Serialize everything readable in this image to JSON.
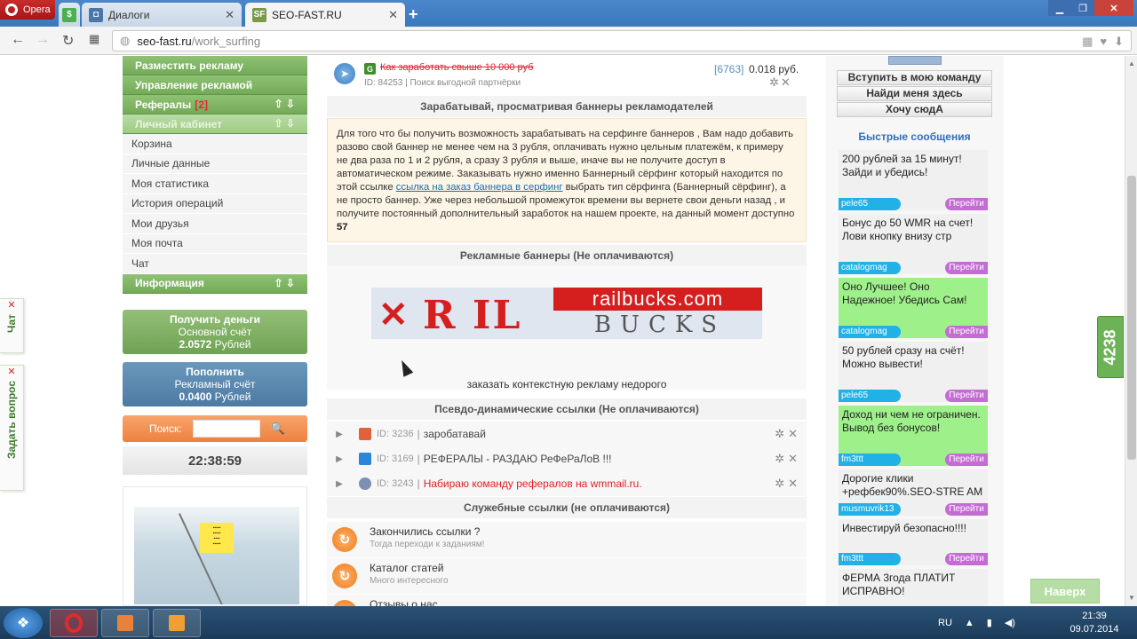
{
  "browser": {
    "opera_label": "Opera",
    "tabs": [
      {
        "title": ""
      },
      {
        "title": "Диалоги"
      },
      {
        "title": "SEO-FAST.RU"
      }
    ],
    "url_domain": "seo-fast.ru",
    "url_path": "/work_surfing"
  },
  "sidebar": {
    "menu": [
      {
        "label": "Разместить рекламу",
        "style": "green"
      },
      {
        "label": "Управление рекламой",
        "style": "green"
      },
      {
        "label": "Рефералы",
        "count": "[2]",
        "style": "green"
      },
      {
        "label": "Личный кабинет",
        "style": "light"
      }
    ],
    "links": [
      "Корзина",
      "Личные данные",
      "Моя статистика",
      "История операций",
      "Мои друзья",
      "Моя почта",
      "Чат"
    ],
    "info_label": "Информация",
    "earn": {
      "title": "Получить деньги",
      "sub": "Основной счёт",
      "amount": "2.0572",
      "unit": "Рублей"
    },
    "pay": {
      "title": "Пополнить",
      "sub": "Рекламный счёт",
      "amount": "0.0400",
      "unit": "Рублей"
    },
    "search_label": "Поиск:",
    "clock": "22:38:59"
  },
  "edge_tabs": {
    "chat": "Чат",
    "ask": "Задать вопрос"
  },
  "center": {
    "top_link": {
      "title": "Как заработать свыше 10 000 руб",
      "meta": "ID: 84253 | Поиск выгодной партнёрки",
      "views": "[6763]",
      "price": "0.018 руб."
    },
    "earn_title": "Зарабатывай, просматривая баннеры рекламодателей",
    "info": {
      "text_before": "Для того что бы получить возможность зарабатывать на серфинге баннеров , Вам надо добавить разово свой баннер не менее чем на 3 рубля, оплачивать нужно цельным платежём, к примеру не два раза по 1 и 2 рубля, а сразу 3 рубля и выше, иначе вы не получите доступ в автоматическом режиме. Заказывать нужно именно Баннерный сёрфинг который находится по этой ссылке",
      "link": "ссылка на заказ баннера в серфинг",
      "text_after": "выбрать тип сёрфинга (Баннерный сёрфинг), а не просто баннер. Уже через небольшой промежуток времени вы вернете свои деньги назад , и получите постоянный дополнительный заработок на нашем проекте, на данный момент доступно",
      "count": "57"
    },
    "banners_title": "Рекламные баннеры (Не оплачиваются)",
    "banner": {
      "brand": "R  IL",
      "url": "railbucks.com",
      "word": "BUCKS"
    },
    "ctx_link": "заказать контекстную рекламу недорого",
    "pseudo_title": "Псевдо-динамические ссылки (Не оплачиваются)",
    "pseudo_links": [
      {
        "id": "ID: 3236",
        "text": "заробатавай",
        "red": false,
        "icon_color": "#e0623a"
      },
      {
        "id": "ID: 3169",
        "text": "РЕФЕРАЛЫ - РАЗДАЮ РеФеРаЛоВ !!!",
        "red": false,
        "icon_color": "#2a86d8"
      },
      {
        "id": "ID: 3243",
        "text": "Набираю команду рефералов на wmmail.ru.",
        "red": true,
        "icon_color": "#7d8fb3"
      }
    ],
    "service_title": "Служебные ссылки (не оплачиваются)",
    "service_links": [
      {
        "title": "Закончились ссылки ?",
        "sub": "Тогда переходи к заданиям!"
      },
      {
        "title": "Каталог статей",
        "sub": "Много интересного"
      },
      {
        "title": "Отзывы о нас",
        "sub": ""
      }
    ]
  },
  "right": {
    "team_buttons": [
      "Вступить в мою команду",
      "Найди меня здесь",
      "Хочу сюдА"
    ],
    "quick_title": "Быстрые сообщения",
    "messages": [
      {
        "text": "200 рублей за 15 минут! Зайди и убедись!",
        "user": "pele65",
        "green": false
      },
      {
        "text": "Бонус до 50 WMR на счет! Лови кнопку внизу стр",
        "user": "catalogmag",
        "green": false
      },
      {
        "text": "Оно Лучшее! Оно Надежное! Убедись Сам!",
        "user": "catalogmag",
        "green": true
      },
      {
        "text": "50 рублей сразу на счёт! Можно вывести!",
        "user": "pele65",
        "green": false
      },
      {
        "text": "Доход ни чем не ограничен. Вывод без бонусов!",
        "user": "fm3ttt",
        "green": true
      },
      {
        "text": "Дорогие клики +рефбек90%.SEO-STRE AM",
        "user": "musmuvrik13",
        "green": false
      },
      {
        "text": "Инвестируй безопасно!!!!",
        "user": "fm3ttt",
        "green": false
      },
      {
        "text": "ФЕРМА 3года ПЛАТИТ ИСПРАВНО!",
        "user": "",
        "green": false
      }
    ],
    "go_label": "Перейти"
  },
  "floating": {
    "counter": "4238",
    "back_top": "Наверх"
  },
  "taskbar": {
    "lang": "RU",
    "time": "21:39",
    "date": "09.07.2014"
  }
}
